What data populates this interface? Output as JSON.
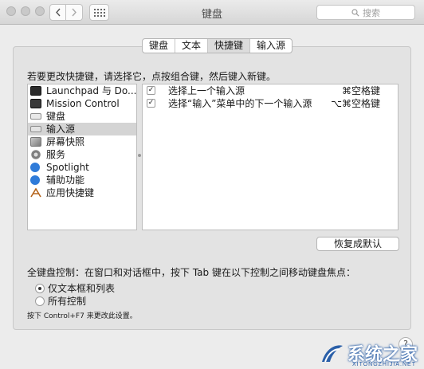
{
  "window": {
    "title": "键盘"
  },
  "search": {
    "placeholder": "搜索"
  },
  "tabs": [
    {
      "label": "键盘",
      "active": false
    },
    {
      "label": "文本",
      "active": false
    },
    {
      "label": "快捷键",
      "active": true
    },
    {
      "label": "输入源",
      "active": false
    }
  ],
  "instruction": "若要更改快捷键，请选择它，点按组合键，然后键入新键。",
  "categories": [
    {
      "label": "Launchpad 与 Do...",
      "icon": "launchpad-dock-icon",
      "selected": false
    },
    {
      "label": "Mission Control",
      "icon": "mission-control-icon",
      "selected": false
    },
    {
      "label": "键盘",
      "icon": "keyboard-icon",
      "selected": false
    },
    {
      "label": "输入源",
      "icon": "input-source-icon",
      "selected": true
    },
    {
      "label": "屏幕快照",
      "icon": "screenshot-icon",
      "selected": false
    },
    {
      "label": "服务",
      "icon": "services-gear-icon",
      "selected": false
    },
    {
      "label": "Spotlight",
      "icon": "spotlight-icon",
      "selected": false
    },
    {
      "label": "辅助功能",
      "icon": "accessibility-icon",
      "selected": false
    },
    {
      "label": "应用快捷键",
      "icon": "app-shortcuts-icon",
      "selected": false
    }
  ],
  "shortcuts": [
    {
      "checked": true,
      "label": "选择上一个输入源",
      "keys": "⌘空格键"
    },
    {
      "checked": true,
      "label": "选择“输入”菜单中的下一个输入源",
      "keys": "⌥⌘空格键"
    }
  ],
  "restore_button": "恢复成默认",
  "keyboard_control": {
    "label": "全键盘控制：在窗口和对话框中，按下 Tab 键在以下控制之间移动键盘焦点：",
    "options": [
      {
        "label": "仅文本框和列表",
        "selected": true
      },
      {
        "label": "所有控制",
        "selected": false
      }
    ],
    "hint": "按下 Control+F7 来更改此设置。"
  },
  "help_label": "?",
  "watermark": {
    "text": "系统之家",
    "sub": "XITONGZHIJIA.NET"
  },
  "colors": {
    "selection": "#d4d4d4",
    "watermark_blue": "#2a5fa8"
  }
}
